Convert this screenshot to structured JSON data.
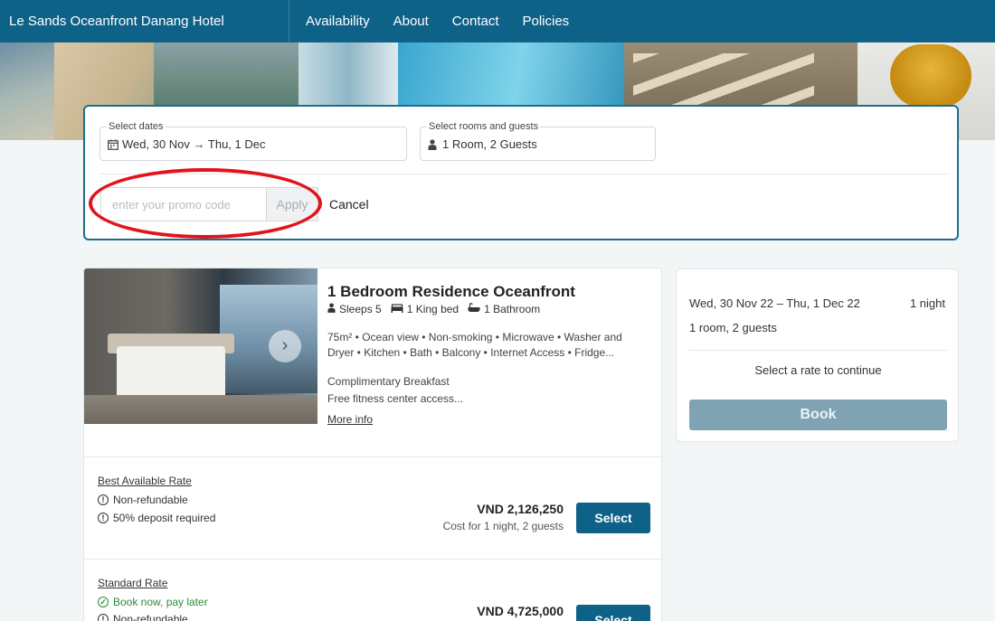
{
  "header": {
    "hotel_name": "Le Sands Oceanfront Danang Hotel",
    "nav": [
      "Availability",
      "About",
      "Contact",
      "Policies"
    ]
  },
  "search": {
    "dates_label": "Select dates",
    "dates_value": "Wed, 30 Nov → Thu, 1 Dec",
    "rooms_label": "Select rooms and guests",
    "rooms_value": "1 Room, 2 Guests",
    "promo_placeholder": "enter your promo code",
    "apply_label": "Apply",
    "cancel_label": "Cancel"
  },
  "room": {
    "title": "1 Bedroom Residence Oceanfront",
    "sleeps": "Sleeps 5",
    "bed": "1 King bed",
    "bathroom": "1 Bathroom",
    "amenities": "75m² • Ocean view • Non-smoking • Microwave • Washer and Dryer • Kitchen • Bath • Balcony • Internet Access • Fridge...",
    "perk_1": "Complimentary Breakfast",
    "perk_2": "Free fitness center access...",
    "more_info": "More info",
    "rates": [
      {
        "name": "Best Available Rate",
        "conditions": [
          "Non-refundable",
          "50% deposit required"
        ],
        "price": "VND 2,126,250",
        "note": "Cost for 1 night, 2 guests",
        "select_label": "Select"
      },
      {
        "name": "Standard Rate",
        "conditions": [
          "Book now, pay later",
          "Non-refundable"
        ],
        "price": "VND 4,725,000",
        "select_label": "Select"
      }
    ]
  },
  "summary": {
    "dates": "Wed, 30 Nov 22 – Thu, 1 Dec 22",
    "nights": "1 night",
    "guests": "1 room, 2 guests",
    "prompt": "Select a rate to continue",
    "book_label": "Book"
  },
  "colors": {
    "brand": "#0e6288",
    "highlight": "#e1141b",
    "book_disabled": "#7fa3b3",
    "success": "#2f8a3a"
  },
  "icons": [
    "calendar-icon",
    "person-icon",
    "bed-icon",
    "bath-icon",
    "info-icon",
    "check-circle-icon",
    "chevron-right-icon"
  ]
}
